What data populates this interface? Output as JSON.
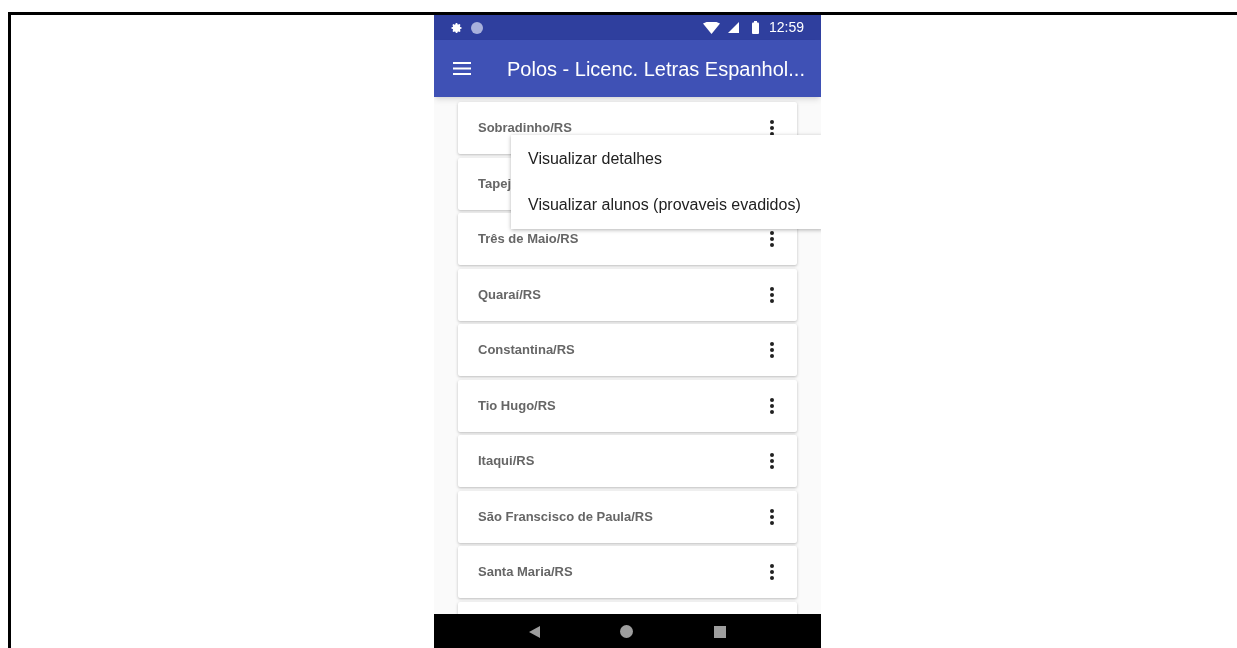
{
  "status_bar": {
    "time": "12:59"
  },
  "app_bar": {
    "title": "Polos - Licenc. Letras Espanhol..."
  },
  "polos": [
    {
      "name": "Sobradinho/RS"
    },
    {
      "name": "Tapej"
    },
    {
      "name": "Três de Maio/RS"
    },
    {
      "name": "Quaraí/RS"
    },
    {
      "name": "Constantina/RS"
    },
    {
      "name": "Tio Hugo/RS"
    },
    {
      "name": "Itaqui/RS"
    },
    {
      "name": "São Franscisco de Paula/RS"
    },
    {
      "name": "Santa Maria/RS"
    }
  ],
  "popup_menu": {
    "items": [
      "Visualizar detalhes",
      "Visualizar alunos (provaveis evadidos)"
    ]
  }
}
